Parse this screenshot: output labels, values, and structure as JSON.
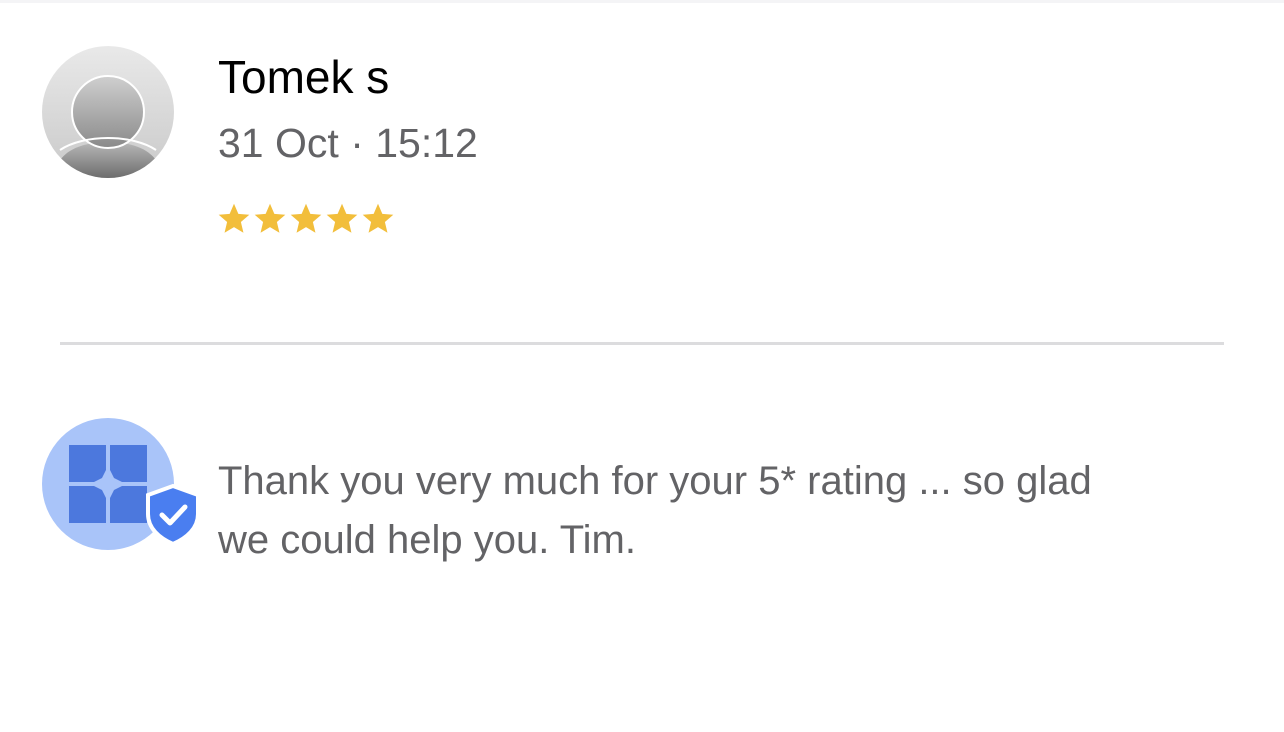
{
  "review": {
    "reviewer_name": "Tomek s",
    "date": "31 Oct",
    "separator": "·",
    "time": "15:12",
    "rating": {
      "value": 5,
      "max": 5,
      "star_color": "#F2BE3B"
    },
    "avatar_icon": "default-person-icon"
  },
  "reply": {
    "text": "Thank you very much for your 5* rating ... so glad we could help you. Tim.",
    "owner_logo_icon": "gift-box-icon",
    "verified_badge_icon": "verified-shield-check-icon",
    "badge_color": "#4A7EF0"
  }
}
